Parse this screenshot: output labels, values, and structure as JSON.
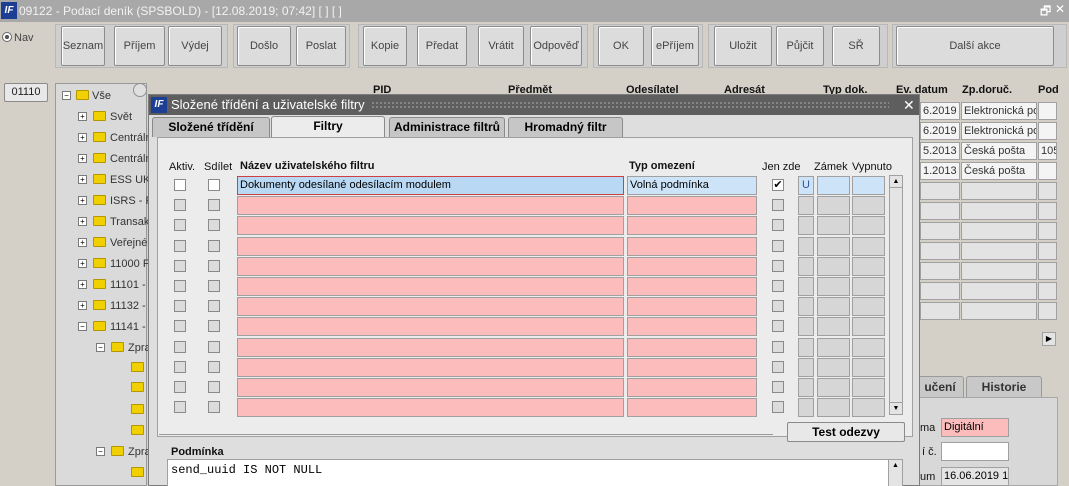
{
  "window": {
    "title": "09122 - Podací deník (SPSBOLD) - [12.08.2019; 07:42]  [ ]  [ ]",
    "logo_text": "IF",
    "restore_glyph": "🗗",
    "close_glyph": "✕"
  },
  "nav": {
    "label": "Nav",
    "code": "01110"
  },
  "toolbar": {
    "buttons": [
      "Seznam",
      "Příjem",
      "Výdej",
      "Došlo",
      "Poslat",
      "Kopie",
      "Předat",
      "Vrátit",
      "Odpověď",
      "OK",
      "ePříjem",
      "Uložit",
      "Půjčit",
      "SŘ",
      "Další akce"
    ]
  },
  "tree": {
    "root": "Vše",
    "items": [
      "Svět",
      "Centrální",
      "Centrální",
      "ESS UK",
      "ISRS - P",
      "Transak",
      "Veřejné",
      "11000 F",
      "11101 -",
      "11132 -",
      "11141 -",
      "Zpra",
      "Zpra"
    ]
  },
  "grid": {
    "headers": [
      "PID",
      "Předmět",
      "Odesílatel",
      "Adresát",
      "Typ dok.",
      "Ev. datum",
      "Zp.doruč.",
      "Pod"
    ],
    "rows": [
      [
        "6.2019",
        "Elektronická po",
        ""
      ],
      [
        "6.2019",
        "Elektronická po",
        ""
      ],
      [
        "5.2013",
        "Česká pošta",
        "105"
      ],
      [
        "1.2013",
        "Česká pošta",
        ""
      ]
    ]
  },
  "right_tabs": {
    "tab1": "učení",
    "tab2": "Historie"
  },
  "right_form": {
    "label1": "ma",
    "value1": "Digitální",
    "label2": "í č.",
    "value2": "",
    "label3": "um",
    "value3": "16.06.2019 1"
  },
  "dialog": {
    "title": "Složené třídění a uživatelské filtry",
    "close": "✕",
    "tabs": [
      "Složené třídění",
      "Filtry",
      "Administrace filtrů",
      "Hromadný filtr"
    ],
    "active_tab": 1,
    "columns": {
      "aktiv": "Aktiv.",
      "sdilet": "Sdílet",
      "nazev": "Název uživatelského filtru",
      "typ": "Typ omezení",
      "jen_zde": "Jen zde",
      "zamek": "Zámek",
      "vypnuto": "Vypnuto"
    },
    "filters": [
      {
        "name": "Dokumenty odesílané odesílacím modulem",
        "type": "Volná podmínka",
        "aktiv": false,
        "sdilet": false,
        "jen_zde": true,
        "zamek": "U"
      }
    ],
    "empty_rows": 11,
    "test_button": "Test odezvy",
    "condition_label": "Podmínka",
    "condition_text": "send_uuid IS NOT NULL"
  }
}
